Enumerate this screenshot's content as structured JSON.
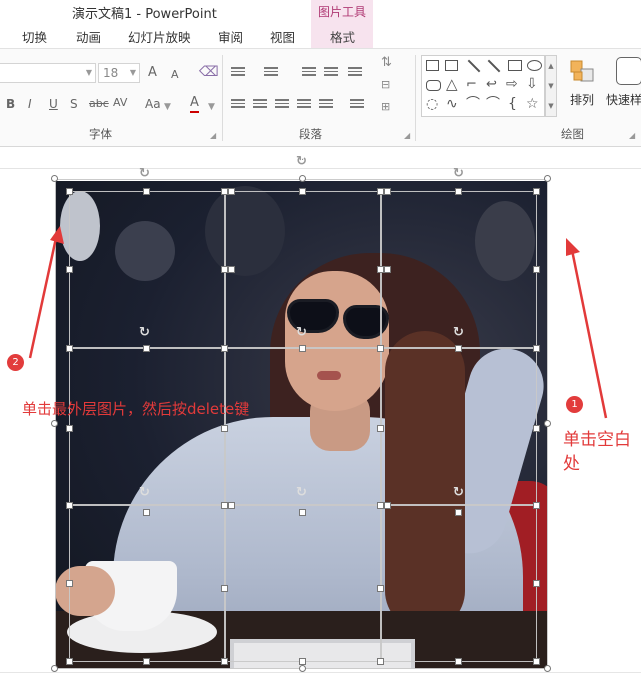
{
  "window": {
    "title": "演示文稿1 - PowerPoint",
    "context_group": "图片工具"
  },
  "tabs": [
    {
      "label": "切换"
    },
    {
      "label": "动画"
    },
    {
      "label": "幻灯片放映"
    },
    {
      "label": "审阅"
    },
    {
      "label": "视图"
    },
    {
      "label": "格式",
      "active": true
    }
  ],
  "ribbon": {
    "font_size": "18",
    "grow_font": "A",
    "shrink_font": "A",
    "bold": "B",
    "italic": "I",
    "underline": "U",
    "shadow": "S",
    "strikethrough": "abc",
    "char_spacing": "AV",
    "change_case": "Aa",
    "font_color": "A",
    "groups": {
      "font": "字体",
      "paragraph": "段落",
      "drawing": "绘图"
    },
    "arrange_label": "排列",
    "quick_styles_label": "快速样"
  },
  "annotations": {
    "step1_number": "1",
    "step1_text": "单击空白处",
    "step2_number": "2",
    "step2_text": "单击最外层图片，然后按delete键"
  },
  "colors": {
    "accent": "#e23a3a",
    "context_tab": "#f7e3ee",
    "context_text": "#b03a74"
  }
}
